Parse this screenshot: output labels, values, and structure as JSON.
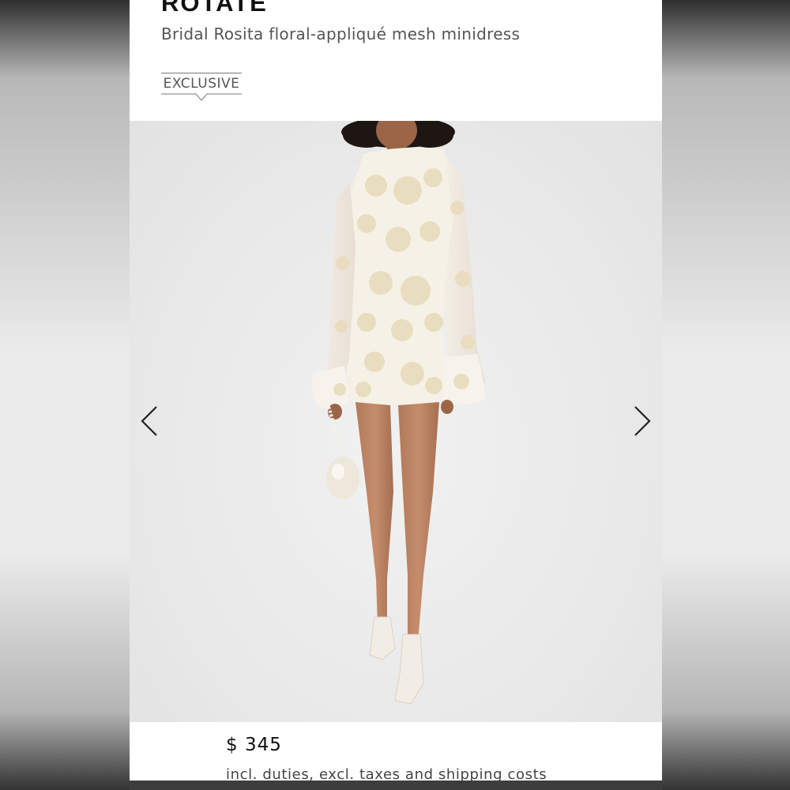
{
  "product": {
    "brand": "ROTATE",
    "name": "Bridal Rosita floral-appliqué mesh minidress",
    "badge": "EXCLUSIVE",
    "price": "$ 345",
    "price_note": "incl. duties, excl. taxes and shipping costs"
  },
  "gallery": {
    "prev_icon": "chevron-left-icon",
    "next_icon": "chevron-right-icon"
  },
  "colors": {
    "background": "#ffffff",
    "image_bg": "#ebebeb",
    "text_primary": "#111111",
    "text_secondary": "#555555",
    "dress": "#f6f1e6",
    "applique": "#e9dcbf"
  }
}
